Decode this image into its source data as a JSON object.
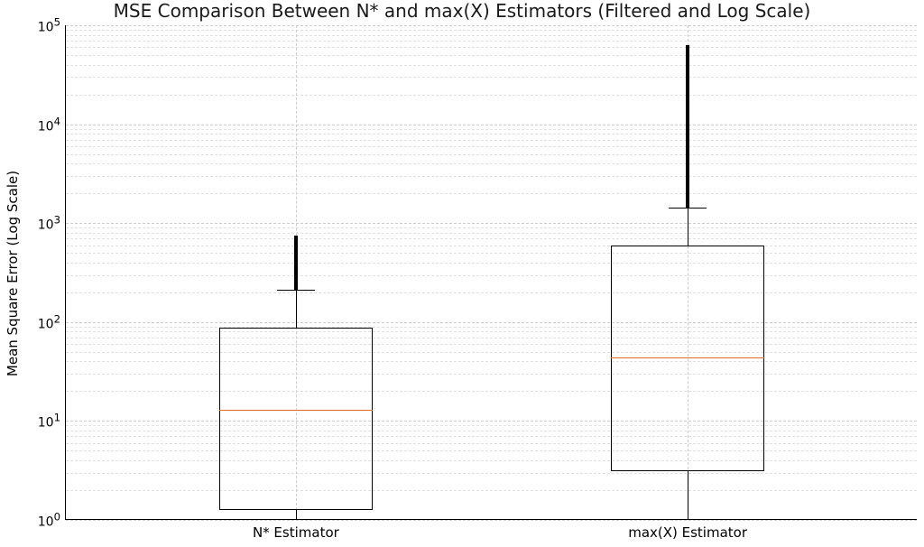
{
  "chart_data": {
    "type": "boxplot",
    "title": "MSE Comparison Between N* and max(X) Estimators (Filtered and Log Scale)",
    "ylabel": "Mean Square Error (Log Scale)",
    "xlabel": "",
    "yscale": "log",
    "ylim": [
      1,
      100000
    ],
    "ytick_labels": [
      "10^0",
      "10^1",
      "10^2",
      "10^3",
      "10^4",
      "10^5"
    ],
    "categories": [
      "N* Estimator",
      "max(X) Estimator"
    ],
    "grid": {
      "major": true,
      "minor": true,
      "style": "dashed"
    },
    "series": [
      {
        "name": "N* Estimator",
        "q1": 1.25,
        "median": 13,
        "q3": 87,
        "whisker_low": 1.0,
        "whisker_high": 210,
        "outlier_range": [
          210,
          750
        ]
      },
      {
        "name": "max(X) Estimator",
        "q1": 3.1,
        "median": 44,
        "q3": 600,
        "whisker_low": 1.0,
        "whisker_high": 1450,
        "outlier_range": [
          1450,
          63000
        ]
      }
    ]
  },
  "ytick_html": {
    "e0": "10<sup>0</sup>",
    "e1": "10<sup>1</sup>",
    "e2": "10<sup>2</sup>",
    "e3": "10<sup>3</sup>",
    "e4": "10<sup>4</sup>",
    "e5": "10<sup>5</sup>"
  }
}
